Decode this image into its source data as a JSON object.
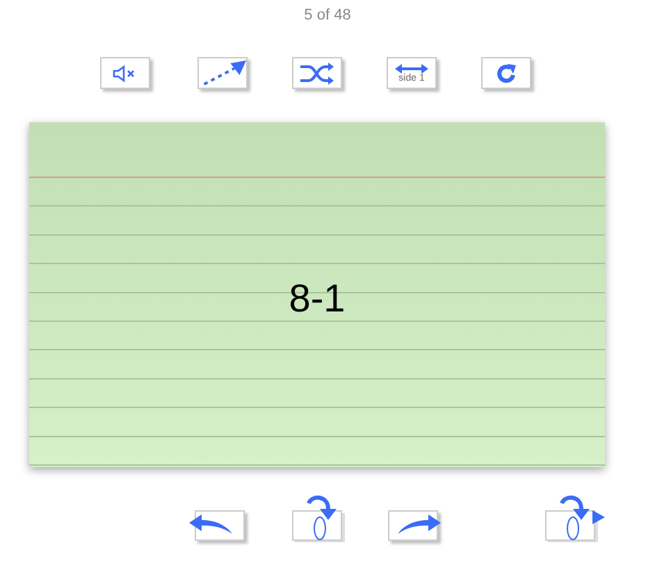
{
  "counter": "5 of 48",
  "toolbar": [
    {
      "kind": "mute"
    },
    {
      "kind": "autoplay"
    },
    {
      "kind": "shuffle"
    },
    {
      "kind": "side",
      "label": "side 1"
    },
    {
      "kind": "restart"
    }
  ],
  "card": {
    "text": "8-1"
  },
  "nav": [
    {
      "kind": "prev"
    },
    {
      "kind": "flip"
    },
    {
      "kind": "next"
    },
    {
      "kind": "flipnext"
    }
  ]
}
